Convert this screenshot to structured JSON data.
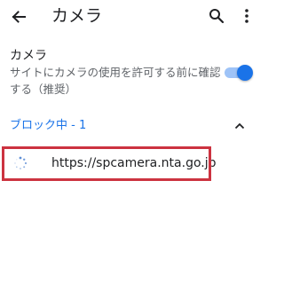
{
  "appbar": {
    "title": "カメラ",
    "back_icon": "arrow-left",
    "search_icon": "magnifier",
    "more_icon": "vertical-ellipsis"
  },
  "camera_toggle": {
    "title": "カメラ",
    "description": "サイトにカメラの使用を許可する前に確認する（推奨）",
    "enabled": true
  },
  "blocked_section": {
    "label": "ブロック中 - 1",
    "expanded": true
  },
  "sites": [
    {
      "url": "https://spcamera.nta.go.jp",
      "icon": "loading-spinner"
    }
  ],
  "colors": {
    "accent": "#1a73e8",
    "toggle_track": "#9ec3f7",
    "highlight": "#cc3340",
    "text_primary": "#202124",
    "text_secondary": "#5f6368"
  }
}
